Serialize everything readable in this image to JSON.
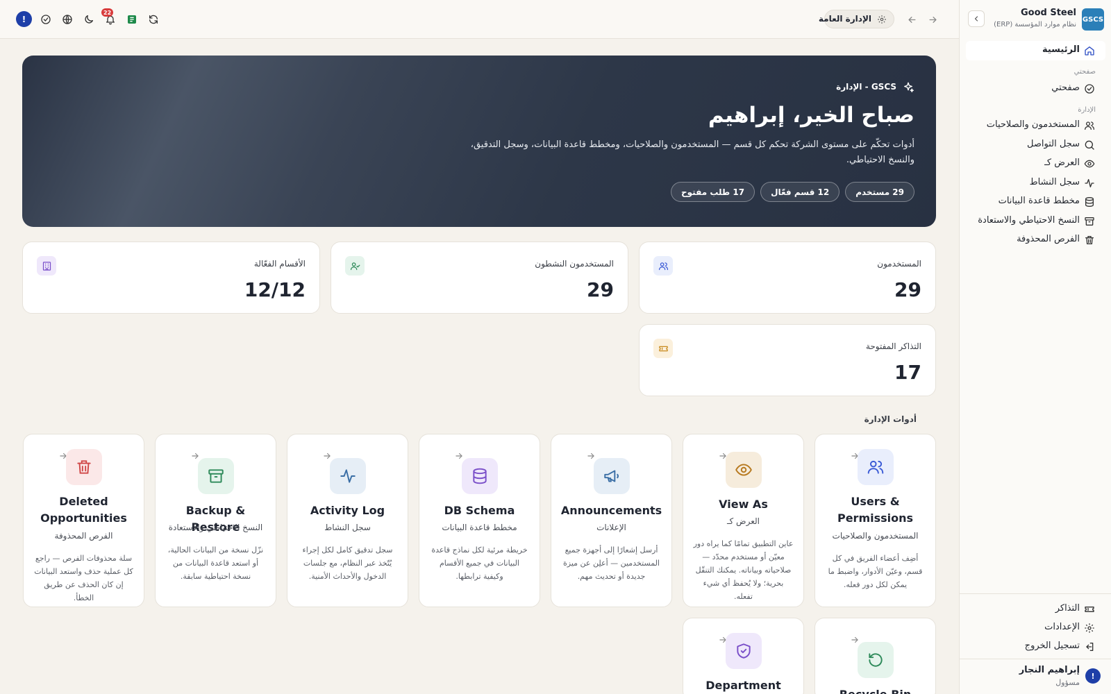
{
  "brand": {
    "logo_text": "GSCS",
    "title": "Good Steel",
    "subtitle": "نظام موارد المؤسسة (ERP)"
  },
  "sidebar": {
    "home": "الرئيسية",
    "section_mypage": "صفحتي",
    "mypage": "صفحتي",
    "section_admin": "الإدارة",
    "items": [
      "المستخدمون والصلاحيات",
      "سجل التواصل",
      "العرض كـ",
      "سجل النشاط",
      "مخطط قاعدة البيانات",
      "النسخ الاحتياطي والاستعادة",
      "الفرص المحذوفة"
    ],
    "bottom": [
      "التذاكر",
      "الإعدادات",
      "تسجيل الخروج"
    ],
    "user": {
      "initial": "!",
      "name": "إبراهيم النجار",
      "role": "مسؤول"
    }
  },
  "topbar": {
    "breadcrumb": "الإدارة العامة",
    "notifications_count": "22",
    "avatar_initial": "!"
  },
  "hero": {
    "tag": "GSCS - الإدارة",
    "title": "صباح الخير، إبراهيم",
    "description": "أدوات تحكّم على مستوى الشركة تحكم كل قسم — المستخدمون والصلاحيات، ومخطط قاعدة البيانات، وسجل التدقيق، والنسخ الاحتياطي.",
    "pills": [
      "29 مستخدم",
      "12 قسم فعّال",
      "17 طلب مفتوح"
    ]
  },
  "stats": [
    {
      "label": "المستخدمون",
      "value": "29",
      "icon": "users-icon",
      "color": "#3b5bd6",
      "bg": "#e9eefc"
    },
    {
      "label": "المستخدمون النشطون",
      "value": "29",
      "icon": "user-check-icon",
      "color": "#2e8a5a",
      "bg": "#e5f4ec"
    },
    {
      "label": "الأقسام الفعّالة",
      "value": "12/12",
      "icon": "building-icon",
      "color": "#7a4fc9",
      "bg": "#efe8fb"
    },
    {
      "label": "التذاكر المفتوحة",
      "value": "17",
      "icon": "ticket-icon",
      "color": "#c88a1e",
      "bg": "#fbf0dc"
    }
  ],
  "tools_title": "أدوات الإدارة",
  "tools": [
    {
      "name": "Users & Permissions",
      "ar": "المستخدمون والصلاحيات",
      "desc": "أضِف أعضاء الفريق في كل قسم، وعيّن الأدوار، واضبط ما يمكن لكل دور فعله.",
      "icon": "users-icon",
      "color": "#3b5bd6",
      "bg": "#e9eefc"
    },
    {
      "name": "View As",
      "ar": "العرض كـ",
      "desc": "عاين التطبيق تمامًا كما يراه دور معيّن أو مستخدم محدّد — صلاحياته وبياناته. يمكنك التنقّل بحرية؛ ولا يُحفظ أي شيء تفعله.",
      "icon": "eye-icon",
      "color": "#b7791f",
      "bg": "#f6ecdc"
    },
    {
      "name": "Announcements",
      "ar": "الإعلانات",
      "desc": "أرسل إشعارًا إلى أجهزة جميع المستخدمين — أعلِن عن ميزة جديدة أو تحديث مهم.",
      "icon": "megaphone-icon",
      "color": "#3a6ea5",
      "bg": "#e6eef6"
    },
    {
      "name": "DB Schema",
      "ar": "مخطط قاعدة البيانات",
      "desc": "خريطة مرئية لكل نماذج قاعدة البيانات في جميع الأقسام وكيفية ترابطها.",
      "icon": "database-icon",
      "color": "#7a4fc9",
      "bg": "#efe8fb"
    },
    {
      "name": "Activity Log",
      "ar": "سجل النشاط",
      "desc": "سجل تدقيق كامل لكل إجراء يُتّخذ عبر النظام، مع جلسات الدخول والأحداث الأمنية.",
      "icon": "activity-icon",
      "color": "#3a6ea5",
      "bg": "#e6eef6"
    },
    {
      "name": "Backup & Restore",
      "ar": "النسخ الاحتياطي والاستعادة",
      "desc": "نزّل نسخة من البيانات الحالية، أو استعد قاعدة البيانات من نسخة احتياطية سابقة.",
      "icon": "archive-icon",
      "color": "#2e8a5a",
      "bg": "#e5f4ec"
    },
    {
      "name": "Deleted Opportunities",
      "ar": "الفرص المحذوفة",
      "desc": "سلة محذوفات الفرص — راجع كل عملية حذف واستعد البيانات إن كان الحذف عن طريق الخطأ.",
      "icon": "trash-icon",
      "color": "#d04848",
      "bg": "#fbe8e8"
    },
    {
      "name": "Recycle Bin",
      "ar": "",
      "desc": "",
      "icon": "restore-icon",
      "color": "#2e8a5a",
      "bg": "#e5f4ec"
    },
    {
      "name": "Department",
      "ar": "",
      "desc": "",
      "icon": "shield-icon",
      "color": "#7a4fc9",
      "bg": "#efe8fb"
    }
  ]
}
